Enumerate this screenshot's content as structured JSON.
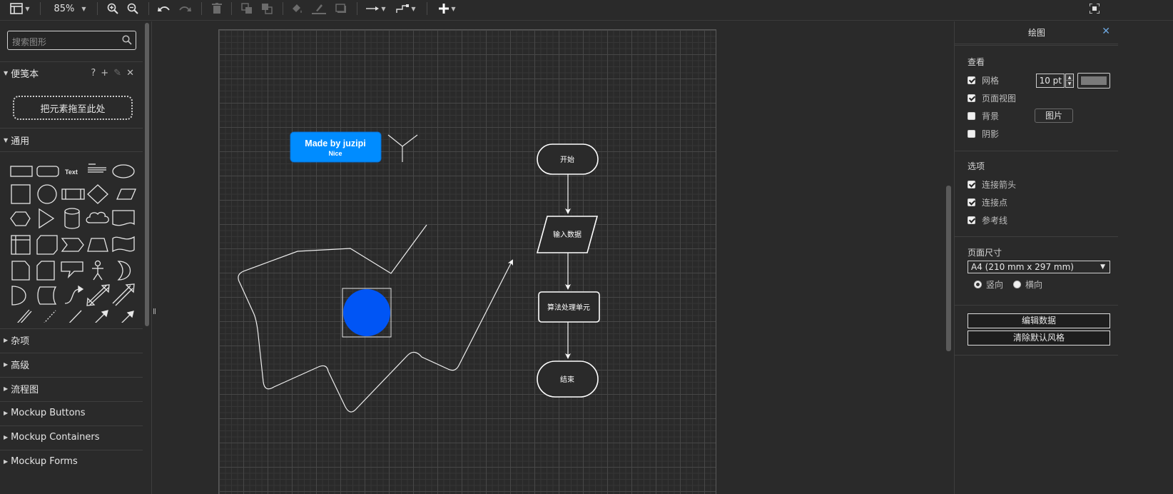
{
  "toolbar": {
    "zoom": "85%",
    "icons": [
      "layout-icon",
      "zoom-in-icon",
      "zoom-out-icon",
      "undo-icon",
      "redo-icon",
      "delete-icon",
      "to-front-icon",
      "to-back-icon",
      "fill-color-icon",
      "line-color-icon",
      "shadow-icon",
      "connection-icon",
      "waypoints-icon",
      "insert-icon",
      "fullscreen-icon"
    ]
  },
  "sidebar": {
    "search_placeholder": "搜索图形",
    "scratchpad": {
      "title": "便笺本",
      "help": "?",
      "drop_hint": "把元素拖至此处"
    },
    "general": {
      "title": "通用",
      "text_shape": "Text"
    },
    "sections": [
      "杂项",
      "高级",
      "流程图",
      "Mockup Buttons",
      "Mockup Containers",
      "Mockup Forms"
    ]
  },
  "diagram": {
    "badge": {
      "title": "Made by juzipi",
      "subtitle": "Nice",
      "color": "#008cff"
    },
    "circle_color": "#0055f5",
    "flow": {
      "start": "开始",
      "input": "输入数据",
      "process": "算法处理单元",
      "end": "结束"
    }
  },
  "panel": {
    "title": "绘图",
    "view": {
      "heading": "查看",
      "grid": {
        "label": "网格",
        "checked": true,
        "size": "10 pt"
      },
      "page_view": {
        "label": "页面视图",
        "checked": true
      },
      "background": {
        "label": "背景",
        "checked": false,
        "button": "图片"
      },
      "shadow": {
        "label": "阴影",
        "checked": false
      }
    },
    "options": {
      "heading": "选项",
      "connection_arrows": {
        "label": "连接箭头",
        "checked": true
      },
      "connection_points": {
        "label": "连接点",
        "checked": true
      },
      "guides": {
        "label": "参考线",
        "checked": true
      }
    },
    "paper": {
      "heading": "页面尺寸",
      "size": "A4 (210 mm x 297 mm)",
      "portrait": "竖向",
      "landscape": "横向",
      "orientation": "portrait"
    },
    "buttons": {
      "edit_data": "编辑数据",
      "clear_style": "清除默认风格"
    }
  }
}
